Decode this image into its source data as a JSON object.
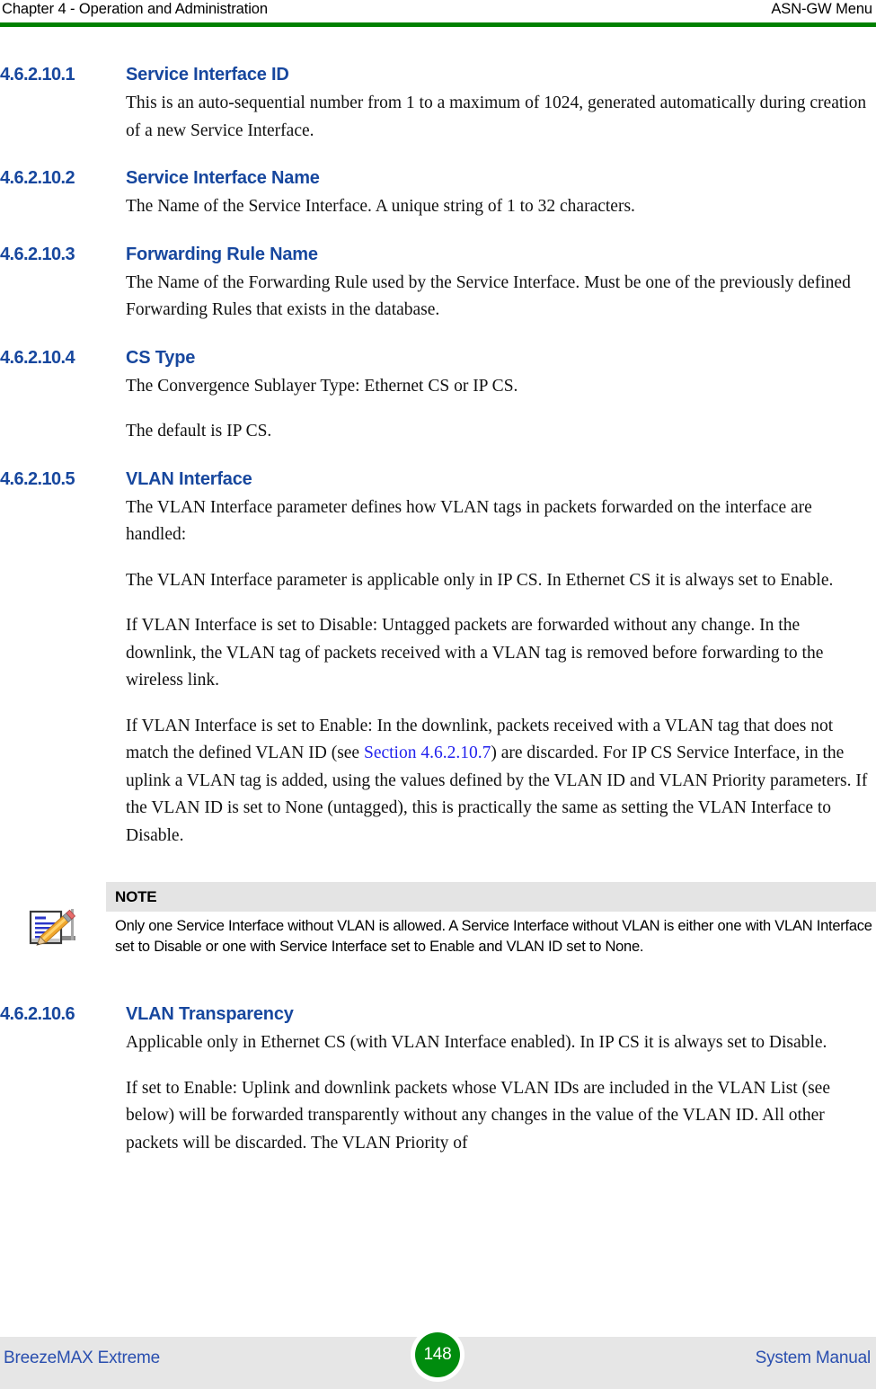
{
  "header": {
    "left": "Chapter 4 - Operation and Administration",
    "right": "ASN-GW Menu",
    "rule_color": "#008000"
  },
  "sections": [
    {
      "number": "4.6.2.10.1",
      "title": "Service Interface ID",
      "paragraphs": [
        "This is an auto-sequential number from 1 to a maximum of 1024, generated automatically during creation of a new Service Interface."
      ]
    },
    {
      "number": "4.6.2.10.2",
      "title": "Service Interface Name",
      "paragraphs": [
        "The Name of the Service Interface. A unique string of 1 to 32 characters."
      ]
    },
    {
      "number": "4.6.2.10.3",
      "title": "Forwarding Rule Name",
      "paragraphs": [
        "The Name of the Forwarding Rule used by the Service Interface. Must be one of the previously defined Forwarding Rules that exists in the database."
      ]
    },
    {
      "number": "4.6.2.10.4",
      "title": "CS Type",
      "paragraphs": [
        "The Convergence Sublayer Type: Ethernet CS or IP CS.",
        "The default is IP CS."
      ]
    },
    {
      "number": "4.6.2.10.5",
      "title": "VLAN Interface",
      "paragraphs": [
        "The VLAN Interface parameter defines how VLAN tags in packets forwarded on the interface are handled:",
        "The VLAN Interface parameter is applicable only in IP CS. In Ethernet CS it is always set to Enable.",
        "If VLAN Interface is set to Disable: Untagged packets are forwarded without any change. In the downlink, the VLAN tag of packets received with a VLAN tag is removed before forwarding to the wireless link."
      ],
      "paragraph_with_link": {
        "before": "If VLAN Interface is set to Enable: In the downlink, packets received with a VLAN tag that does not match the defined VLAN ID (see ",
        "link": "Section 4.6.2.10.7",
        "after": ") are discarded. For IP CS Service Interface, in the uplink a VLAN tag is added, using the values defined by the VLAN ID and VLAN Priority parameters. If the VLAN ID is set to None (untagged), this is practically the same as setting the VLAN Interface to Disable."
      }
    },
    {
      "number": "4.6.2.10.6",
      "title": "VLAN Transparency",
      "paragraphs": [
        "Applicable only in Ethernet CS (with VLAN Interface enabled). In IP CS it is always set to Disable.",
        "If set to Enable: Uplink and downlink packets whose VLAN IDs are included in the VLAN List (see below) will be forwarded transparently without any changes in the value of the VLAN ID. All other packets will be discarded. The VLAN Priority of"
      ]
    }
  ],
  "note": {
    "icon": "notepad-pencil-icon",
    "label": "NOTE",
    "text": "Only one Service Interface without VLAN is allowed. A Service Interface without VLAN is either one with VLAN Interface set to Disable or one with Service Interface set to Enable and VLAN ID set to None.",
    "header_background": "#E4E4E4"
  },
  "footer": {
    "left": "BreezeMAX Extreme",
    "page_number": "148",
    "right": "System Manual",
    "badge_color": "#008C0E",
    "text_color": "#2A4FAF",
    "background": "#E6E6E6"
  }
}
